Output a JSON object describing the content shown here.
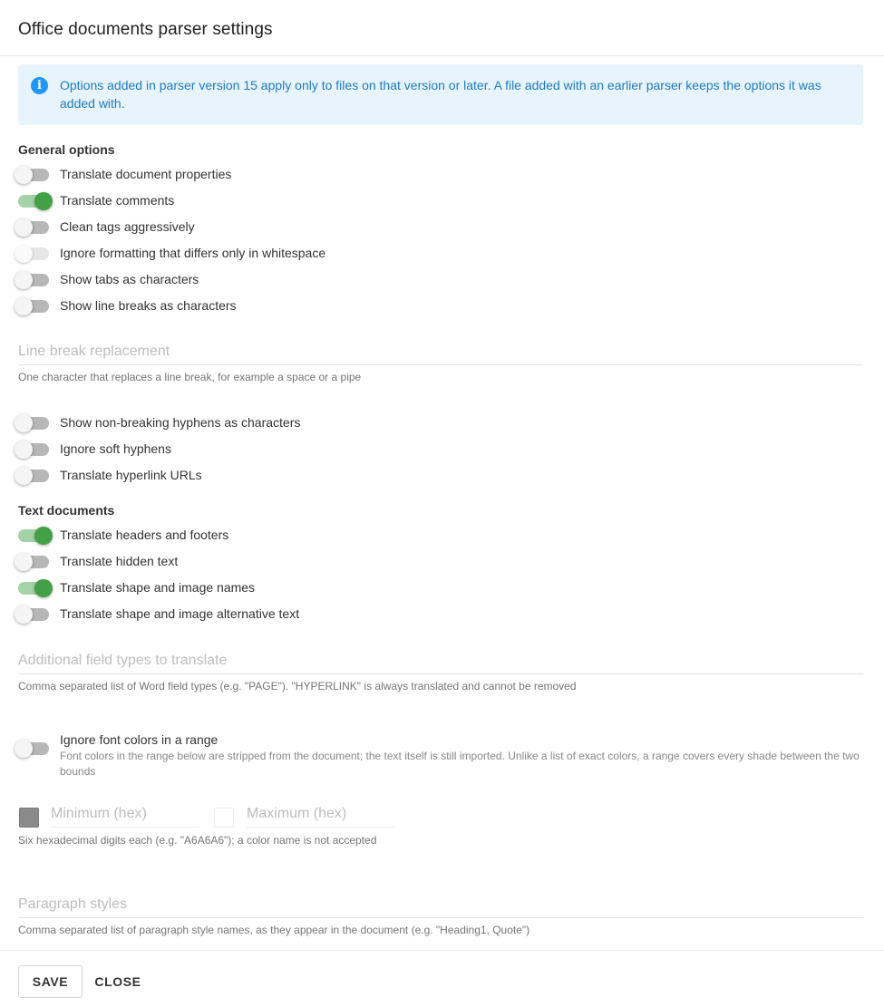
{
  "dialog": {
    "title": "Office documents parser settings"
  },
  "info": {
    "icon": "info-icon",
    "text": "Options added in parser version 15 apply only to files on that version or later. A file added with an earlier parser keeps the options it was added with."
  },
  "general": {
    "title": "General options",
    "toggles": [
      {
        "label": "Translate document properties",
        "on": false
      },
      {
        "label": "Translate comments",
        "on": true
      },
      {
        "label": "Clean tags aggressively",
        "on": false
      },
      {
        "label": "Ignore formatting that differs only in whitespace",
        "on": false,
        "disabled": true
      },
      {
        "label": "Show tabs as characters",
        "on": false
      },
      {
        "label": "Show line breaks as characters",
        "on": false
      }
    ]
  },
  "line_break": {
    "placeholder": "Line break replacement",
    "value": "",
    "helper": "One character that replaces a line break, for example a space or a pipe"
  },
  "more_toggles": [
    {
      "label": "Show non-breaking hyphens as characters",
      "on": false
    },
    {
      "label": "Ignore soft hyphens",
      "on": false
    },
    {
      "label": "Translate hyperlink URLs",
      "on": false
    }
  ],
  "text_docs": {
    "title": "Text documents",
    "toggles": [
      {
        "label": "Translate headers and footers",
        "on": true
      },
      {
        "label": "Translate hidden text",
        "on": false
      },
      {
        "label": "Translate shape and image names",
        "on": true
      },
      {
        "label": "Translate shape and image alternative text",
        "on": false
      }
    ]
  },
  "field_types": {
    "placeholder": "Additional field types to translate",
    "value": "",
    "helper": "Comma separated list of Word field types (e.g. \"PAGE\"). \"HYPERLINK\" is always translated and cannot be removed"
  },
  "font_colors": {
    "label": "Ignore font colors in a range",
    "on": false,
    "description": "Font colors in the range below are stripped from the document; the text itself is still imported. Unlike a list of exact colors, a range covers every shade between the two bounds",
    "min_placeholder": "Minimum (hex)",
    "max_placeholder": "Maximum (hex)",
    "min_swatch_color": "#8a8a8a",
    "max_swatch_color": "#ffffff",
    "helper": "Six hexadecimal digits each (e.g. \"A6A6A6\"); a color name is not accepted"
  },
  "paragraph_styles": {
    "placeholder": "Paragraph styles",
    "value": "",
    "helper": "Comma separated list of paragraph style names, as they appear in the document (e.g. \"Heading1, Quote\")"
  },
  "footer": {
    "save_label": "SAVE",
    "close_label": "CLOSE"
  },
  "colors": {
    "accent_green": "#43a047",
    "info_blue": "#2196f3",
    "info_bg": "#e8f4fc"
  }
}
